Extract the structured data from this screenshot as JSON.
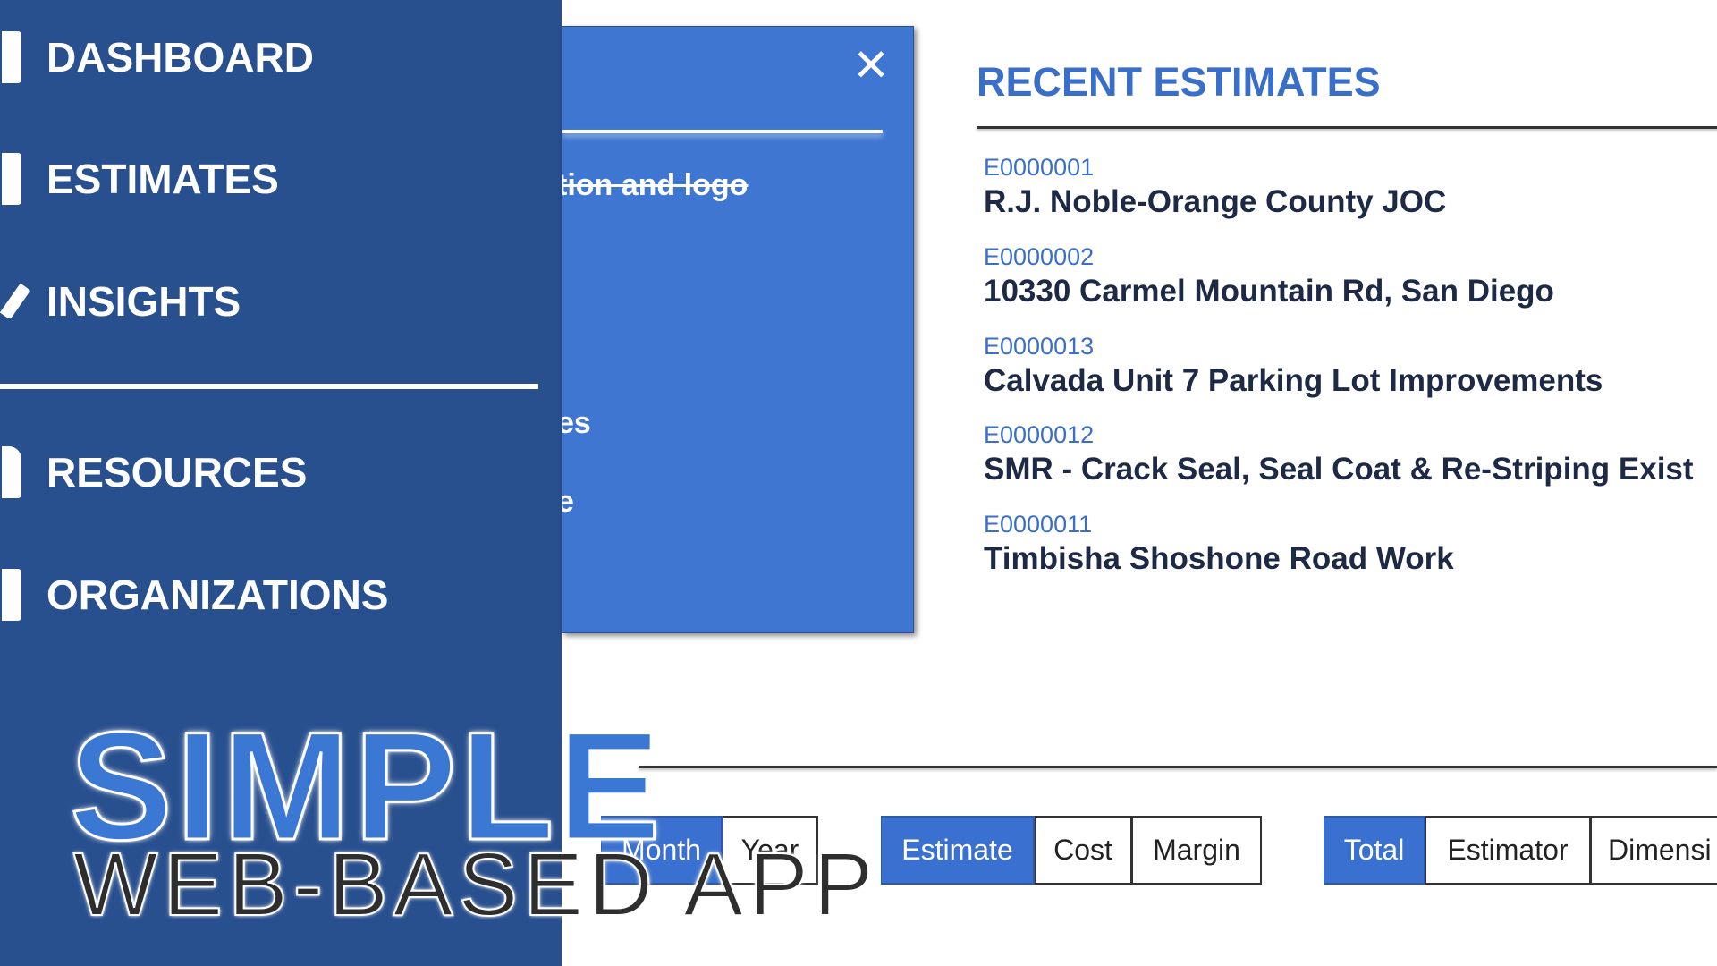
{
  "sidebar": {
    "items": [
      {
        "label": "DASHBOARD",
        "icon": "dashboard-icon"
      },
      {
        "label": "ESTIMATES",
        "icon": "estimates-icon"
      },
      {
        "label": "INSIGHTS",
        "icon": "insights-icon"
      },
      {
        "label": "RESOURCES",
        "icon": "person-icon"
      },
      {
        "label": "ORGANIZATIONS",
        "icon": "building-icon"
      }
    ]
  },
  "modal": {
    "close": "✕",
    "lines": [
      "tion and logo",
      "es",
      "e"
    ]
  },
  "recent": {
    "title": "RECENT ESTIMATES",
    "items": [
      {
        "id": "E0000001",
        "name": "R.J. Noble-Orange County JOC"
      },
      {
        "id": "E0000002",
        "name": "10330 Carmel Mountain Rd, San Diego"
      },
      {
        "id": "E0000013",
        "name": "Calvada Unit 7 Parking Lot Improvements"
      },
      {
        "id": "E0000012",
        "name": "SMR - Crack Seal, Seal Coat & Re-Striping Exist"
      },
      {
        "id": "E0000011",
        "name": "Timbisha Shoshone Road Work"
      }
    ]
  },
  "toggles": {
    "period": [
      "Month",
      "Year"
    ],
    "measure": [
      "Estimate",
      "Cost",
      "Margin"
    ],
    "group": [
      "Total",
      "Estimator",
      "Dimensi"
    ]
  },
  "overlay": {
    "line1": "SIMPLE",
    "line2": "WEB-BASED APP"
  },
  "colors": {
    "sidebar": "#284f8e",
    "modal": "#3f76d1",
    "accent": "#3a70cf"
  }
}
